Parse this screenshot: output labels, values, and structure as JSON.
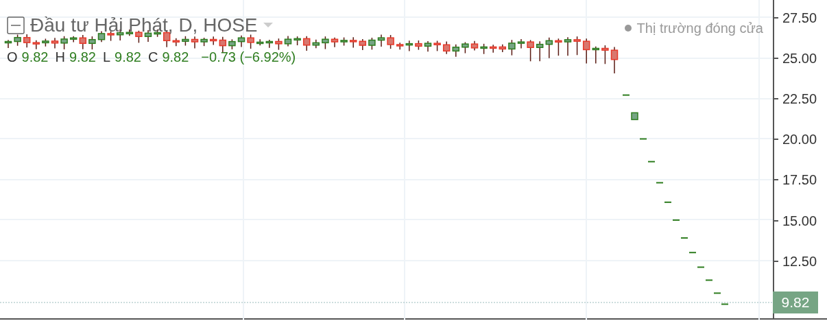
{
  "header": {
    "title": "Đầu tư Hải Phát, D, HOSE",
    "legend": [
      {
        "label": "O",
        "value": "9.82"
      },
      {
        "label": "H",
        "value": "9.82"
      },
      {
        "label": "L",
        "value": "9.82"
      },
      {
        "label": "C",
        "value": "9.82"
      }
    ],
    "change": "−0.73 (−6.92%)"
  },
  "market_status": {
    "text": "Thị trường đóng cửa",
    "open": false
  },
  "price_axis": {
    "labels": [
      "27.50",
      "25.00",
      "22.50",
      "20.00",
      "17.50",
      "15.00",
      "12.50"
    ]
  },
  "last_price": {
    "text": "9.82"
  }
}
